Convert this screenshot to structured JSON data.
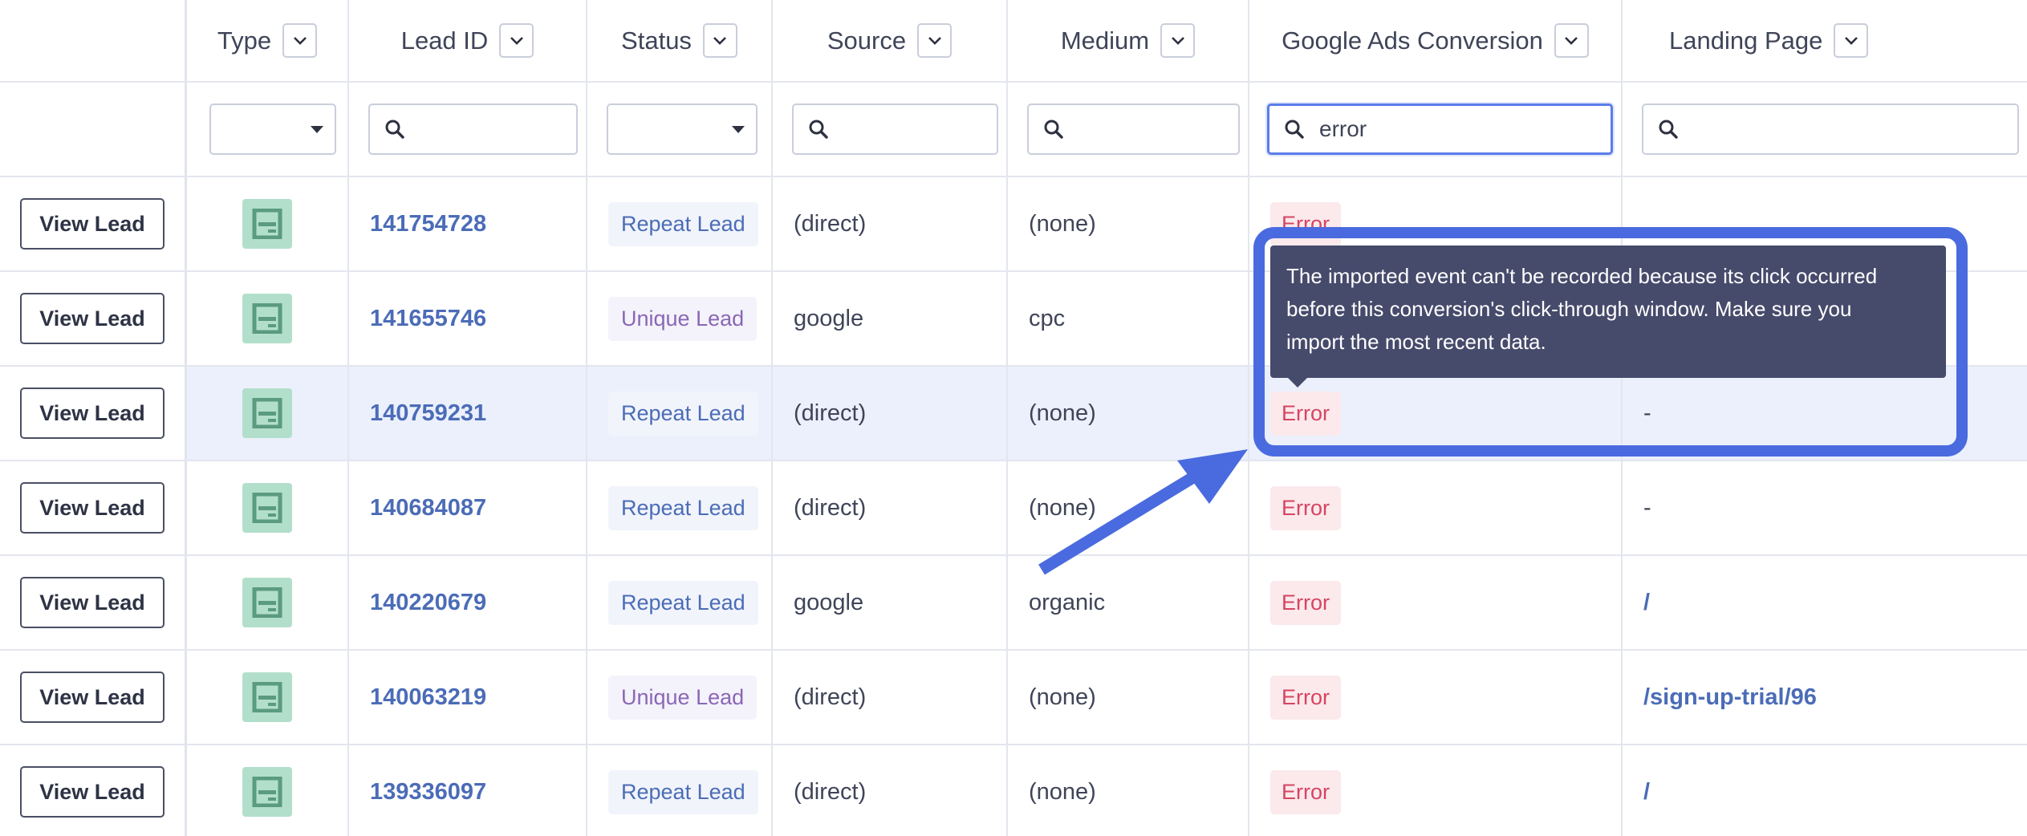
{
  "headers": [
    {
      "label": "Type"
    },
    {
      "label": "Lead ID"
    },
    {
      "label": "Status"
    },
    {
      "label": "Source"
    },
    {
      "label": "Medium"
    },
    {
      "label": "Google Ads Conversion"
    },
    {
      "label": "Landing Page"
    }
  ],
  "filters": {
    "type_value": "",
    "lead_id_value": "",
    "status_value": "",
    "source_value": "",
    "medium_value": "",
    "google_ads_value": "error",
    "landing_page_value": ""
  },
  "view_lead_label": "View Lead",
  "rows": [
    {
      "lead_id": "141754728",
      "status": "Repeat Lead",
      "source": "(direct)",
      "medium": "(none)",
      "conversion": "Error",
      "landing_page": ""
    },
    {
      "lead_id": "141655746",
      "status": "Unique Lead",
      "source": "google",
      "medium": "cpc",
      "conversion": "",
      "landing_page": ""
    },
    {
      "lead_id": "140759231",
      "status": "Repeat Lead",
      "source": "(direct)",
      "medium": "(none)",
      "conversion": "Error",
      "landing_page": "-"
    },
    {
      "lead_id": "140684087",
      "status": "Repeat Lead",
      "source": "(direct)",
      "medium": "(none)",
      "conversion": "Error",
      "landing_page": "-"
    },
    {
      "lead_id": "140220679",
      "status": "Repeat Lead",
      "source": "google",
      "medium": "organic",
      "conversion": "Error",
      "landing_page": "/"
    },
    {
      "lead_id": "140063219",
      "status": "Unique Lead",
      "source": "(direct)",
      "medium": "(none)",
      "conversion": "Error",
      "landing_page": "/sign-up-trial/96"
    },
    {
      "lead_id": "139336097",
      "status": "Repeat Lead",
      "source": "(direct)",
      "medium": "(none)",
      "conversion": "Error",
      "landing_page": "/"
    }
  ],
  "tooltip": {
    "line1": "The imported event can't be recorded because its click occurred",
    "line2": "before this conversion's click-through window. Make sure you",
    "line3": "import the most recent data."
  },
  "colors": {
    "accent": "#4a6bdf",
    "link": "#4b6cb7",
    "error_text": "#d64561",
    "error_bg": "#fbe9ec",
    "type_icon_bg": "#b2dfcb",
    "tooltip_bg": "#464a6b",
    "highlight_row": "#ebf0fc"
  }
}
